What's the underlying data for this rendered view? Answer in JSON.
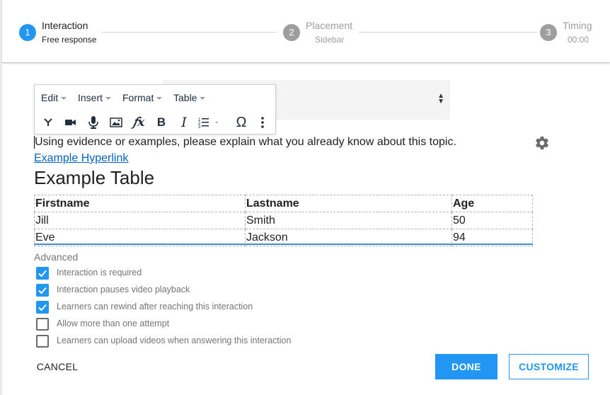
{
  "stepper": {
    "steps": [
      {
        "number": "1",
        "title": "Interaction",
        "subtitle": "Free response"
      },
      {
        "number": "2",
        "title": "Placement",
        "subtitle": "Sidebar"
      },
      {
        "number": "3",
        "title": "Timing",
        "subtitle": "00:00"
      }
    ]
  },
  "toolbar": {
    "menus": [
      "Edit",
      "Insert",
      "Format",
      "Table"
    ],
    "tools": [
      "branch-icon",
      "video-icon",
      "microphone-icon",
      "image-icon",
      "formula-icon",
      "bold-icon",
      "italic-icon",
      "list-icon",
      "omega-icon",
      "more-icon"
    ]
  },
  "editor": {
    "paragraph": "Using evidence or examples, please explain what you already know about this topic.",
    "link": "Example Hyperlink",
    "heading": "Example Table",
    "table": {
      "headers": [
        "Firstname",
        "Lastname",
        "Age"
      ],
      "rows": [
        [
          "Jill",
          "Smith",
          "50"
        ],
        [
          "Eve",
          "Jackson",
          "94"
        ]
      ]
    }
  },
  "advanced": {
    "title": "Advanced",
    "options": [
      {
        "label": "Interaction is required",
        "checked": true
      },
      {
        "label": "Interaction pauses video playback",
        "checked": true
      },
      {
        "label": "Learners can rewind after reaching this interaction",
        "checked": true
      },
      {
        "label": "Allow more than one attempt",
        "checked": false
      },
      {
        "label": "Learners can upload videos when answering this interaction",
        "checked": false
      }
    ]
  },
  "footer": {
    "cancel": "CANCEL",
    "done": "DONE",
    "customize": "CUSTOMIZE"
  },
  "colors": {
    "accent": "#2196f3",
    "inactive_step": "#9e9e9e",
    "link": "#0563c1"
  }
}
